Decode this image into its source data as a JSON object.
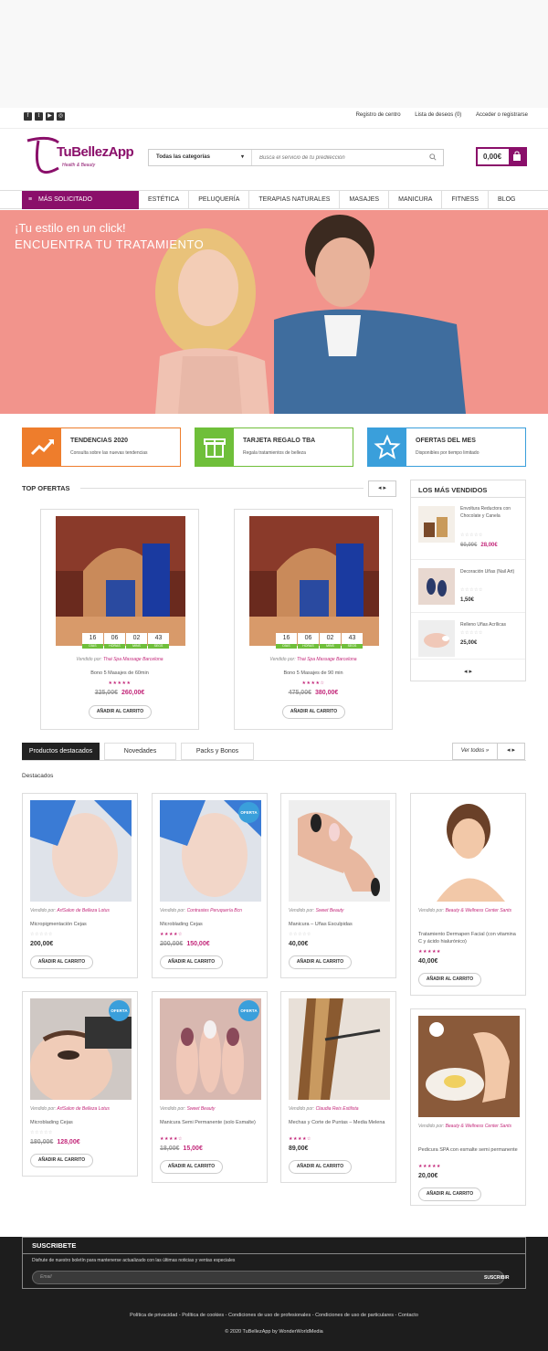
{
  "topbar": {
    "social": [
      "f",
      "t",
      "▶",
      "◎"
    ],
    "links": [
      "Registro de centro",
      "Lista de deseos (0)",
      "Acceder o registrarse"
    ]
  },
  "logo": {
    "name": "TuBellezApp",
    "tagline": "Health & Beauty"
  },
  "search": {
    "category": "Todas las categorías",
    "placeholder": "Busca el servicio de tu predilección"
  },
  "cart": {
    "amount": "0,00€"
  },
  "nav": {
    "featured": "MÁS SOLICITADO",
    "items": [
      "ESTÉTICA",
      "PELUQUERÍA",
      "TERAPIAS NATURALES",
      "MASAJES",
      "MANICURA",
      "FITNESS",
      "BLOG"
    ]
  },
  "hero": {
    "line1": "¡Tu estilo en un click!",
    "line2": "ENCUENTRA TU TRATAMIENTO"
  },
  "features": [
    {
      "title": "TENDENCIAS 2020",
      "sub": "Consulta sobre las nuevas tendencias",
      "color": "#ee7d2c",
      "icon": "trend-icon"
    },
    {
      "title": "TARJETA REGALO TBA",
      "sub": "Regala tratamientos de belleza",
      "color": "#6fbf3a",
      "icon": "gift-icon"
    },
    {
      "title": "OFERTAS DEL MES",
      "sub": "Disponibles por tiempo limitado",
      "color": "#3a9fdb",
      "icon": "star-icon"
    }
  ],
  "top_offers": {
    "title": "TOP OFERTAS",
    "arrows": "◂ ▸",
    "cards": [
      {
        "timer": [
          "16",
          "06",
          "02",
          "43"
        ],
        "timer_labels": [
          "DÍAS",
          "HORAS",
          "MINS",
          "SEGS"
        ],
        "vendor_prefix": "Vendido por:",
        "vendor": "Thai Spa Massage Barcelona",
        "name": "Bono 5 Masajes de 60min",
        "stars": "★★★★★",
        "old": "325,00€",
        "new": "260,00€",
        "button": "AÑADIR AL CARRITO"
      },
      {
        "timer": [
          "16",
          "06",
          "02",
          "43"
        ],
        "timer_labels": [
          "DÍAS",
          "HORAS",
          "MINS",
          "SEGS"
        ],
        "vendor_prefix": "Vendido por:",
        "vendor": "Thai Spa Massage Barcelona",
        "name": "Bono 5 Masajes de 90 min",
        "stars": "★★★★☆",
        "old": "475,00€",
        "new": "380,00€",
        "button": "AÑADIR AL CARRITO"
      }
    ]
  },
  "bestsellers": {
    "title": "LOS MÁS VENDIDOS",
    "arrows": "◂ ▸",
    "items": [
      {
        "name": "Envoltura Reductora con Chocolate y Canela",
        "stars": "☆☆☆☆☆",
        "old": "60,00€",
        "new": "28,00€"
      },
      {
        "name": "Decoración Uñas (Nail Art)",
        "stars": "☆☆☆☆☆",
        "price": "1,50€"
      },
      {
        "name": "Relleno Uñas Acrílicas",
        "stars": "☆☆☆☆☆",
        "price": "25,00€"
      }
    ]
  },
  "product_tabs": {
    "tabs": [
      "Productos destacados",
      "Novedades",
      "Packs y Bonos"
    ],
    "see_all": "Ver todos »",
    "arrows": "◂ ▸",
    "subtitle": "Destacados"
  },
  "products": [
    {
      "vendor_prefix": "Vendido por:",
      "vendor": "ArtSalon de Belleza Lotus",
      "name": "Micropigmentación Cejas",
      "stars": "☆☆☆☆☆",
      "price": "200,00€",
      "button": "AÑADIR AL CARRITO"
    },
    {
      "vendor_prefix": "Vendido por:",
      "vendor": "Contrastes Peruquería Bcn",
      "name": "Microblading Cejas",
      "stars": "★★★★☆",
      "old": "200,00€",
      "new": "150,00€",
      "badge": "OFERTA",
      "button": "AÑADIR AL CARRITO"
    },
    {
      "vendor_prefix": "Vendido por:",
      "vendor": "Sweet Beauty",
      "name": "Manicura – Uñas Esculpidas",
      "stars": "☆☆☆☆☆",
      "price": "40,00€",
      "button": "AÑADIR AL CARRITO"
    },
    {
      "vendor_prefix": "Vendido por:",
      "vendor": "Beauty & Wellness Center Sants",
      "name": "Tratamiento Dermapen Facial (con vitamina C y ácido hialurónico)",
      "stars": "★★★★★",
      "price": "40,00€",
      "button": "AÑADIR AL CARRITO"
    },
    {
      "vendor_prefix": "Vendido por:",
      "vendor": "ArtSalon de Belleza Lotus",
      "name": "Microblading Cejas",
      "stars": "☆☆☆☆☆",
      "old": "180,00€",
      "new": "128,00€",
      "badge": "OFERTA",
      "button": "AÑADIR AL CARRITO"
    },
    {
      "vendor_prefix": "Vendido por:",
      "vendor": "Sweet Beauty",
      "name": "Manicura Semi Permanente (solo Esmalte)",
      "stars": "★★★★☆",
      "old": "18,00€",
      "new": "15,00€",
      "badge": "OFERTA",
      "button": "AÑADIR AL CARRITO"
    },
    {
      "vendor_prefix": "Vendido por:",
      "vendor": "Claudia Reis Estilista",
      "name": "Mechas y Corte de Puntas – Media Melena",
      "stars": "★★★★☆",
      "price": "89,00€",
      "button": "AÑADIR AL CARRITO"
    },
    {
      "vendor_prefix": "Vendido por:",
      "vendor": "Beauty & Wellness Center Sants",
      "name": "Pedicura SPA con esmalte semi permanente",
      "stars": "★★★★★",
      "price": "20,00€",
      "button": "AÑADIR AL CARRITO"
    }
  ],
  "footer": {
    "subscribe_title": "SUSCRIBETE",
    "subscribe_desc": "Disfrute de nuestro boletín para mantenerse actualizado con las últimas noticias y ventas especiales",
    "email_placeholder": "Email",
    "subscribe_button": "SUSCRIBIR",
    "links": "Política de privacidad - Política de cookies - Condiciones de uso de profesionales - Condiciones de uso de particulares - Contacto",
    "copyright": "© 2020 TuBellezApp by WonderWorldMedia"
  },
  "colors": {
    "brand": "#8a0f6a",
    "accent": "#c3287a"
  }
}
